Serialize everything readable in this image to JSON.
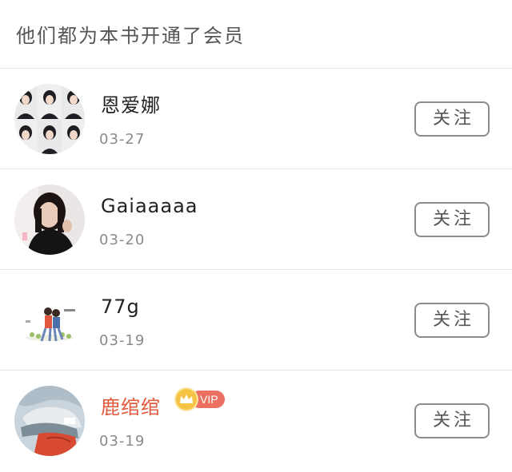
{
  "header": {
    "title": "他们都为本书开通了会员"
  },
  "members": [
    {
      "name": "恩爱娜",
      "date": "03-27",
      "follow_label": "关注",
      "vip": false,
      "avatar_icon": "photo-grid-avatar"
    },
    {
      "name": "Gaiaaaaa",
      "date": "03-20",
      "follow_label": "关注",
      "vip": false,
      "avatar_icon": "portrait-avatar"
    },
    {
      "name": "77g",
      "date": "03-19",
      "follow_label": "关注",
      "vip": false,
      "avatar_icon": "illustration-avatar"
    },
    {
      "name": "鹿绾绾",
      "date": "03-19",
      "follow_label": "关注",
      "vip": true,
      "vip_label": "VIP",
      "avatar_icon": "anime-avatar"
    }
  ],
  "colors": {
    "vip_name": "#e05a3c",
    "vip_badge": "#ec7062",
    "crown": "#f6c344",
    "divider": "#e6e6e6",
    "button_border": "#8c8c8c"
  }
}
